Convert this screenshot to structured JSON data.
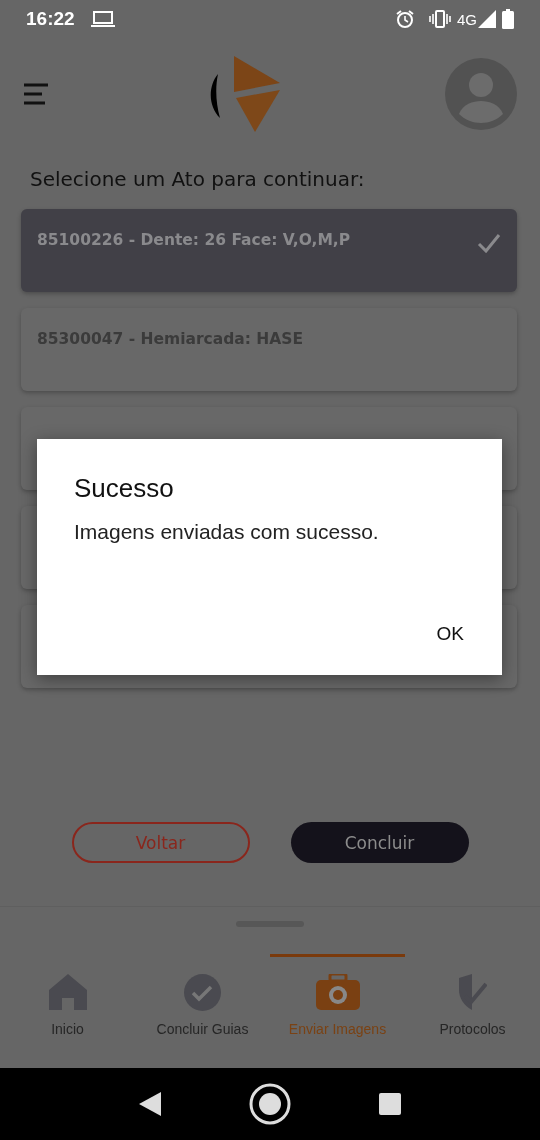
{
  "status_bar": {
    "time": "16:22",
    "network": "4G"
  },
  "prompt": "Selecione um Ato para continuar:",
  "acts": [
    {
      "label": "85100226 - Dente: 26 Face: V,O,M,P",
      "selected": true
    },
    {
      "label": "85300047 - Hemiarcada: HASE",
      "selected": false
    },
    {
      "selected": false
    },
    {
      "selected": false
    },
    {
      "selected": false
    }
  ],
  "buttons": [
    {
      "label": "Voltar",
      "kind": "outline"
    },
    {
      "label": "Concluir",
      "kind": "filled"
    }
  ],
  "tabs": [
    {
      "label": "Inicio",
      "kind": "home",
      "selected": false
    },
    {
      "label": "Concluir Guias",
      "kind": "check",
      "selected": false
    },
    {
      "label": "Enviar Imagens",
      "kind": "camera",
      "selected": true
    },
    {
      "label": "Protocolos",
      "kind": "shield",
      "selected": false
    }
  ],
  "dialog": {
    "title": "Sucesso",
    "message": "Imagens enviadas com sucesso.",
    "button": "OK"
  }
}
